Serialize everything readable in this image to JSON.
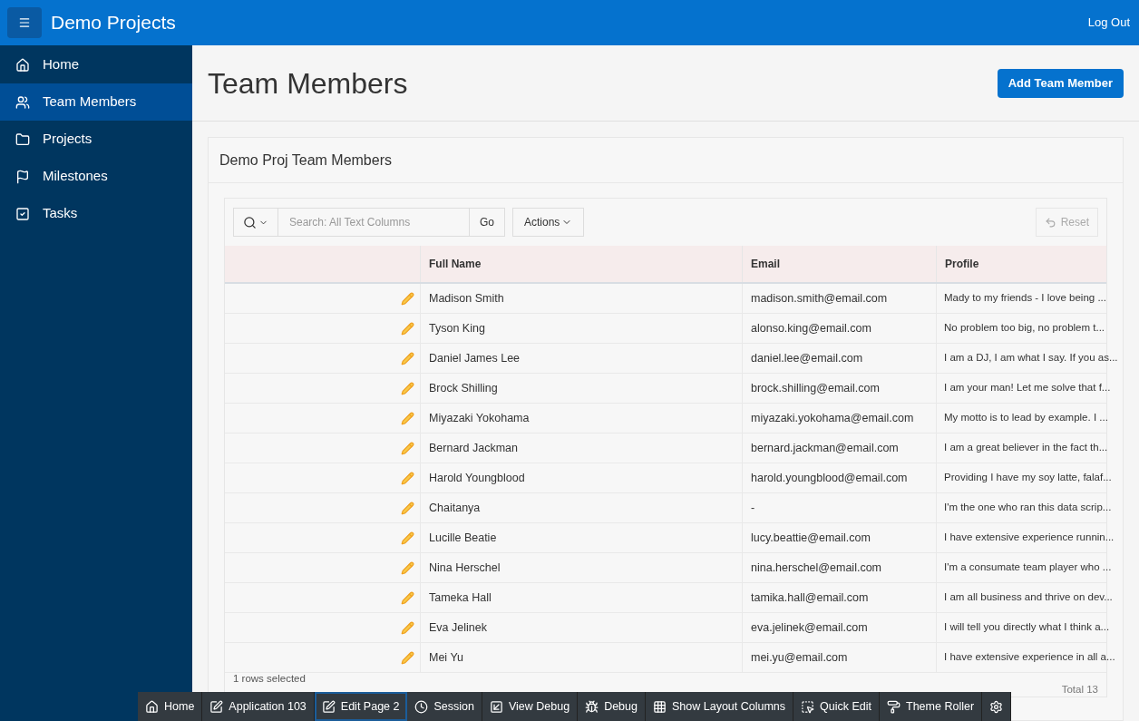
{
  "header": {
    "app_title": "Demo Projects",
    "logout": "Log Out"
  },
  "sidebar": {
    "items": [
      {
        "label": "Home",
        "selected": false
      },
      {
        "label": "Team Members",
        "selected": true
      },
      {
        "label": "Projects",
        "selected": false
      },
      {
        "label": "Milestones",
        "selected": false
      },
      {
        "label": "Tasks",
        "selected": false
      }
    ]
  },
  "page": {
    "title": "Team Members",
    "add_button": "Add Team Member"
  },
  "report": {
    "title": "Demo Proj Team Members",
    "search": {
      "placeholder": "Search: All Text Columns"
    },
    "go": "Go",
    "actions": "Actions",
    "reset": "Reset",
    "columns": [
      "Full Name",
      "Email",
      "Profile"
    ],
    "rows": [
      {
        "name": "Madison Smith",
        "email": "madison.smith@email.com",
        "profile": "Mady to my friends - I love being ..."
      },
      {
        "name": "Tyson King",
        "email": "alonso.king@email.com",
        "profile": "No problem too big, no problem t..."
      },
      {
        "name": "Daniel James Lee",
        "email": "daniel.lee@email.com",
        "profile": "I am a DJ, I am what I say. If you as..."
      },
      {
        "name": "Brock Shilling",
        "email": "brock.shilling@email.com",
        "profile": "I am your man! Let me solve that f..."
      },
      {
        "name": "Miyazaki Yokohama",
        "email": "miyazaki.yokohama@email.com",
        "profile": "My motto is to lead by example. I ..."
      },
      {
        "name": "Bernard Jackman",
        "email": "bernard.jackman@email.com",
        "profile": "I am a great believer in the fact th..."
      },
      {
        "name": "Harold Youngblood",
        "email": "harold.youngblood@email.com",
        "profile": "Providing I have my soy latte, falaf..."
      },
      {
        "name": "Chaitanya",
        "email": "-",
        "profile": "I'm the one who ran this data scrip..."
      },
      {
        "name": "Lucille Beatie",
        "email": "lucy.beattie@email.com",
        "profile": "I have extensive experience runnin..."
      },
      {
        "name": "Nina Herschel",
        "email": "nina.herschel@email.com",
        "profile": "I'm a consumate team player who ..."
      },
      {
        "name": "Tameka Hall",
        "email": "tamika.hall@email.com",
        "profile": "I am all business and thrive on dev..."
      },
      {
        "name": "Eva Jelinek",
        "email": "eva.jelinek@email.com",
        "profile": "I will tell you directly what I think a..."
      },
      {
        "name": "Mei Yu",
        "email": "mei.yu@email.com",
        "profile": "I have extensive experience in all a..."
      }
    ],
    "selection": "1 rows selected",
    "total": "Total 13"
  },
  "dev_toolbar": [
    {
      "label": "Home",
      "selected": false
    },
    {
      "label": "Application 103",
      "selected": false
    },
    {
      "label": "Edit Page 2",
      "selected": true
    },
    {
      "label": "Session",
      "selected": false
    },
    {
      "label": "View Debug",
      "selected": false
    },
    {
      "label": "Debug",
      "selected": false
    },
    {
      "label": "Show Layout Columns",
      "selected": false
    },
    {
      "label": "Quick Edit",
      "selected": false
    },
    {
      "label": "Theme Roller",
      "selected": false
    },
    {
      "selected": false
    }
  ]
}
